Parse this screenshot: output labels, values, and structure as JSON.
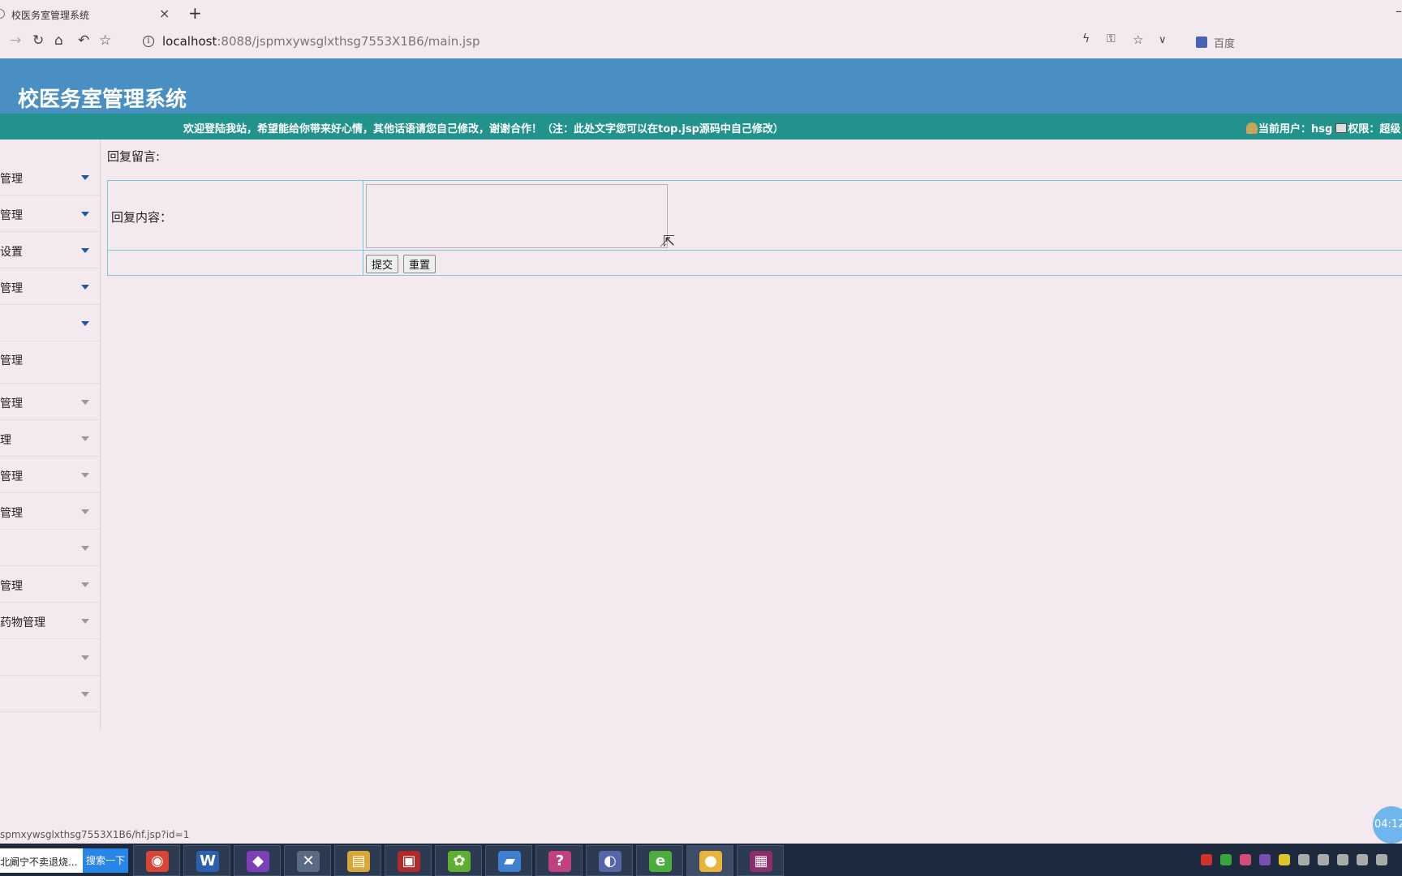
{
  "browser": {
    "tab_title": "校医务室管理系统",
    "tab_close": "×",
    "new_tab": "+",
    "minimize": "–",
    "url_host": "localhost",
    "url_path": ":8088/jspmxywsglxthsg7553X1B6/main.jsp",
    "search_engine": "百度",
    "status_url": "spmxywsglxthsg7553X1B6/hf.jsp?id=1"
  },
  "app": {
    "title": "校医务室管理系统",
    "welcome": "欢迎登陆我站，希望能给你带来好心情，其他话语请您自己修改，谢谢合作！（注：此处文字您可以在top.jsp源码中自己修改）",
    "current_user_label": "当前用户：hsg",
    "permission_label": "权限：超级"
  },
  "sidebar": {
    "items": [
      {
        "label": "管理",
        "arrow": "blue"
      },
      {
        "label": "管理",
        "arrow": "blue"
      },
      {
        "label": "设置",
        "arrow": "blue"
      },
      {
        "label": "管理",
        "arrow": "blue"
      },
      {
        "label": "",
        "arrow": "blue"
      },
      {
        "label": "管理",
        "arrow": "none"
      },
      {
        "label": "管理",
        "arrow": "grey"
      },
      {
        "label": "理",
        "arrow": "grey"
      },
      {
        "label": "管理",
        "arrow": "grey"
      },
      {
        "label": "管理",
        "arrow": "grey"
      },
      {
        "label": "",
        "arrow": "grey"
      },
      {
        "label": "管理",
        "arrow": "grey"
      },
      {
        "label": "药物管理",
        "arrow": "grey"
      },
      {
        "label": "",
        "arrow": "grey"
      },
      {
        "label": "",
        "arrow": "grey"
      }
    ]
  },
  "main": {
    "heading": "回复留言:",
    "field_label": "回复内容：",
    "reply_value": "",
    "submit_label": "提交",
    "reset_label": "重置"
  },
  "overlay": {
    "timer": "04:12"
  },
  "taskbar": {
    "search_text": "北阚宁不卖退烧...",
    "search_button": "搜索一下",
    "apps": [
      {
        "name": "chrome",
        "glyph": "◉",
        "color": "#d94436"
      },
      {
        "name": "word",
        "glyph": "W",
        "color": "#2b5fb4"
      },
      {
        "name": "visual-studio",
        "glyph": "◆",
        "color": "#7d3fb8"
      },
      {
        "name": "tools",
        "glyph": "✕",
        "color": "#5a6a80"
      },
      {
        "name": "file-explorer",
        "glyph": "▤",
        "color": "#d8a736"
      },
      {
        "name": "red-app",
        "glyph": "▣",
        "color": "#b02a2a"
      },
      {
        "name": "green-leaf",
        "glyph": "✿",
        "color": "#5db030"
      },
      {
        "name": "folder-app",
        "glyph": "▰",
        "color": "#3f7fd0"
      },
      {
        "name": "support",
        "glyph": "?",
        "color": "#c04080"
      },
      {
        "name": "eclipse",
        "glyph": "◐",
        "color": "#5566a8"
      },
      {
        "name": "green-browser",
        "glyph": "e",
        "color": "#4cae3a"
      },
      {
        "name": "recorder",
        "glyph": "●",
        "color": "#e8b43a"
      },
      {
        "name": "winrar",
        "glyph": "▦",
        "color": "#8a2f6a"
      }
    ],
    "tray_colors": [
      "#d0322c",
      "#3aa33a",
      "#d24e7a",
      "#7a4fb0",
      "#e0c22a",
      "#aaaaaa",
      "#aaaaaa",
      "#aaaaaa",
      "#aaaaaa",
      "#aaaaaa"
    ]
  }
}
